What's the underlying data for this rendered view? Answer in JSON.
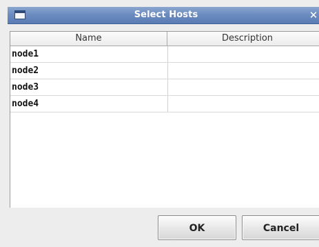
{
  "window": {
    "title": "Select Hosts",
    "close_symbol": "✕"
  },
  "table": {
    "columns": [
      "Name",
      "Description"
    ],
    "rows": [
      {
        "name": "node1",
        "description": ""
      },
      {
        "name": "node2",
        "description": ""
      },
      {
        "name": "node3",
        "description": ""
      },
      {
        "name": "node4",
        "description": ""
      }
    ]
  },
  "buttons": {
    "ok_label": "OK",
    "cancel_label": "Cancel"
  },
  "icons": {
    "window_icon": "window-icon",
    "close": "close-icon"
  },
  "colors": {
    "titlebar": "#6c8cc0",
    "table_background": "#ffffff",
    "dialog_background": "#ededed"
  }
}
